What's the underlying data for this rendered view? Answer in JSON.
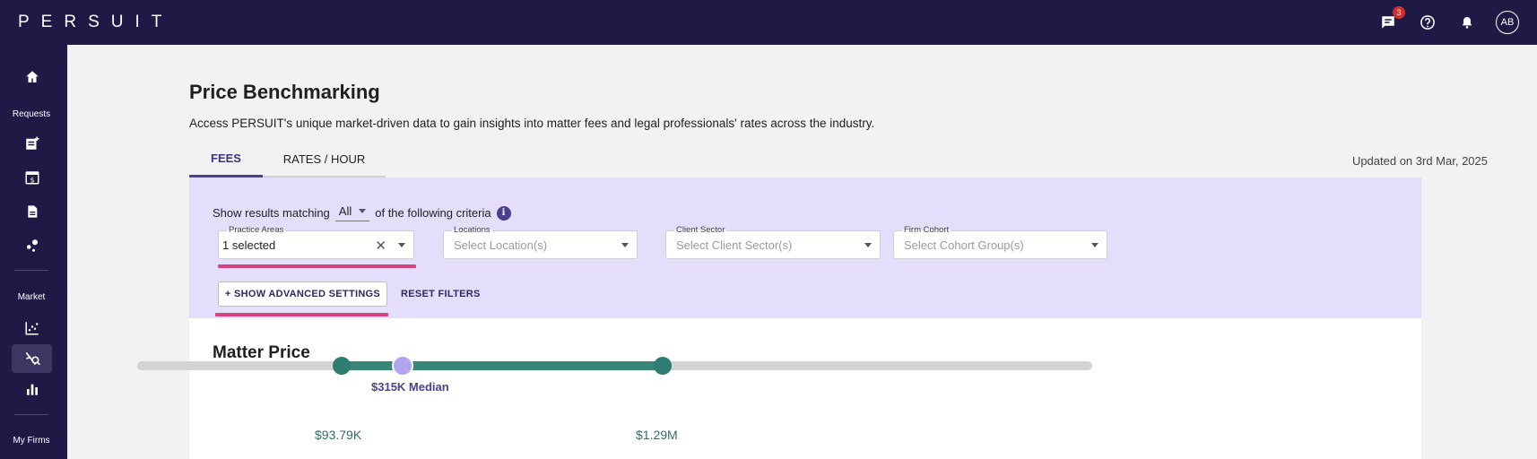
{
  "app": {
    "logo": "PERSUIT"
  },
  "topbar": {
    "notification_count": "3",
    "avatar_initials": "AB"
  },
  "sidebar": {
    "sections": {
      "requests": "Requests",
      "market": "Market",
      "my_firms": "My Firms"
    }
  },
  "page": {
    "title": "Price Benchmarking",
    "subtitle": "Access PERSUIT's unique market-driven data to gain insights into matter fees and legal professionals' rates across the industry.",
    "updated": "Updated on 3rd Mar, 2025"
  },
  "tabs": [
    {
      "label": "FEES",
      "active": true
    },
    {
      "label": "RATES / HOUR",
      "active": false
    }
  ],
  "filters": {
    "criteria_prefix": "Show results matching",
    "criteria_value": "All",
    "criteria_suffix": "of the following criteria",
    "practice_areas": {
      "label": "Practice Areas",
      "value": "1 selected"
    },
    "locations": {
      "label": "Locations",
      "placeholder": "Select Location(s)"
    },
    "client_sector": {
      "label": "Client Sector",
      "placeholder": "Select Client Sector(s)"
    },
    "firm_cohort": {
      "label": "Firm Cohort",
      "placeholder": "Select Cohort Group(s)"
    },
    "advanced_label": "+ SHOW ADVANCED SETTINGS",
    "reset_label": "RESET FILTERS"
  },
  "matter_price": {
    "title": "Matter Price",
    "median_label": "$315K Median",
    "min_label": "$93.79K",
    "max_label": "$1.29M"
  },
  "colors": {
    "nav": "#1f1a45",
    "accent": "#4b3f8f",
    "filter_panel": "#e4defb",
    "range": "#38857a",
    "highlight": "#d6427d"
  }
}
